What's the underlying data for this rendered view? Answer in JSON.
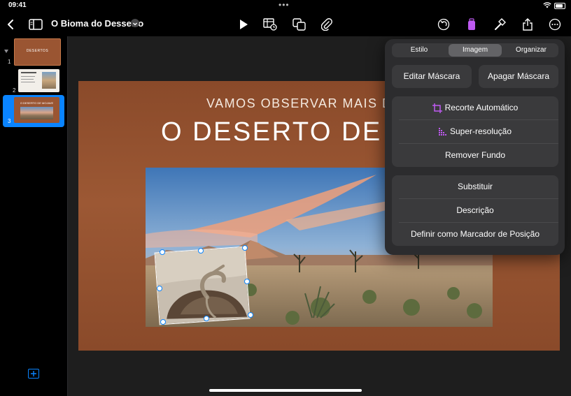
{
  "status_bar": {
    "time": "09:41"
  },
  "toolbar": {
    "title": "O Bioma do Desserto"
  },
  "sidebar": {
    "slides": [
      {
        "number": "1",
        "thumb_text": "DESERTOS"
      },
      {
        "number": "2",
        "thumb_text": ""
      },
      {
        "number": "3",
        "thumb_text": "O DESERTO DE MOJAVE"
      }
    ]
  },
  "slide": {
    "subtitle": "VAMOS OBSERVAR MAIS DE",
    "title": "O DESERTO DE M"
  },
  "popover": {
    "tabs": [
      "Estilo",
      "Imagem",
      "Organizar"
    ],
    "active_tab": "Imagem",
    "edit_mask": "Editar Máscara",
    "remove_mask": "Apagar Máscara",
    "auto_crop": "Recorte Automático",
    "super_res": "Super-resolução",
    "remove_bg": "Remover Fundo",
    "replace": "Substituir",
    "description": "Descrição",
    "placeholder": "Definir como Marcador de Posição"
  },
  "colors": {
    "accent": "#0a84ff",
    "selected_icon": "#bf5af2"
  }
}
